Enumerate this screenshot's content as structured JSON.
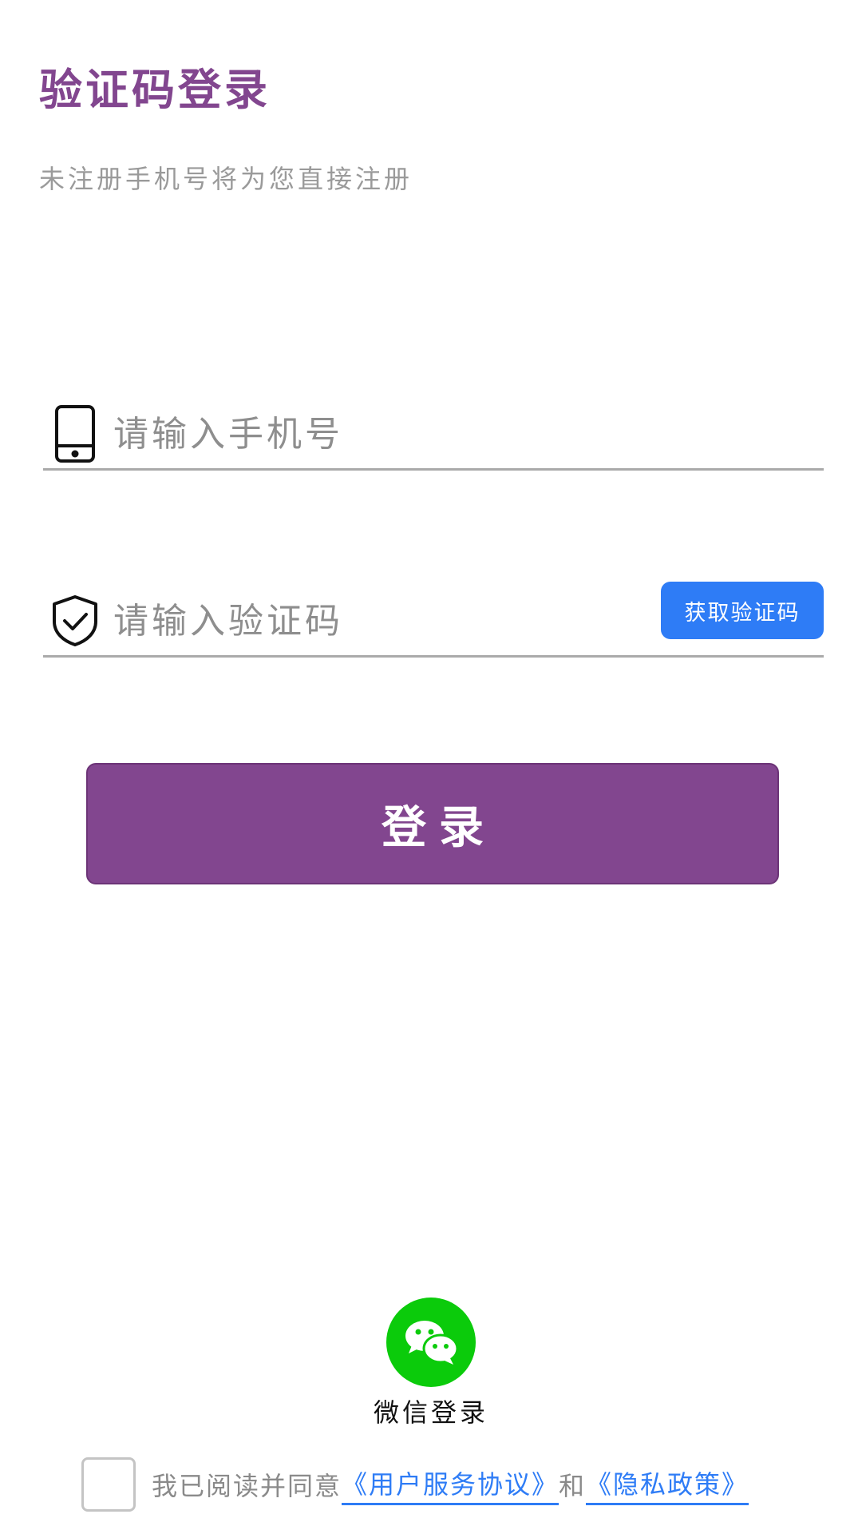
{
  "header": {
    "title": "验证码登录",
    "subtitle": "未注册手机号将为您直接注册"
  },
  "form": {
    "phone": {
      "placeholder": "请输入手机号",
      "icon": "phone-icon"
    },
    "code": {
      "placeholder": "请输入验证码",
      "icon": "shield-check-icon",
      "get_code_label": "获取验证码"
    },
    "login_label": "登录"
  },
  "social": {
    "wechat_label": "微信登录",
    "icon": "wechat-icon"
  },
  "agreement": {
    "prefix": "我已阅读并同意",
    "user_agreement": "《用户服务协议》",
    "and": "和",
    "privacy_policy": "《隐私政策》",
    "checked": false
  },
  "colors": {
    "brand_purple": "#82468F",
    "button_blue": "#2E7CF6",
    "wechat_green": "#0BCB0B",
    "hint_gray": "#9A9A9A"
  }
}
